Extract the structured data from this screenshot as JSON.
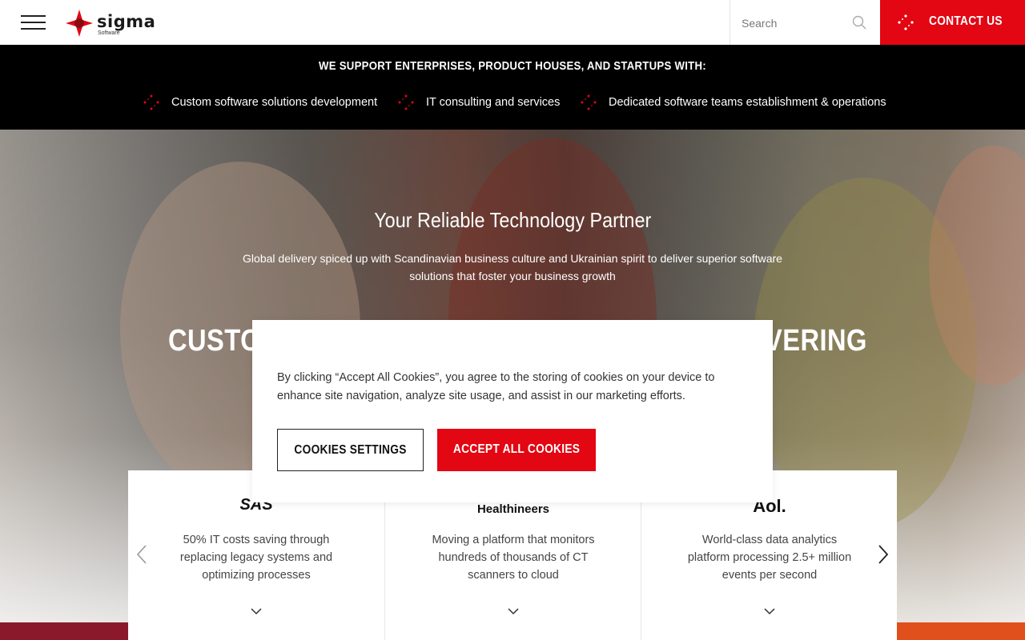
{
  "header": {
    "logo_text": "sigma",
    "logo_sub": "Software",
    "search_placeholder": "Search",
    "contact_label": "CONTACT US"
  },
  "band": {
    "title": "WE SUPPORT ENTERPRISES, PRODUCT HOUSES, AND STARTUPS WITH:",
    "items": [
      "Custom software solutions development",
      "IT consulting and services",
      "Dedicated software teams establishment & operations"
    ]
  },
  "hero": {
    "title": "Your Reliable Technology Partner",
    "subtitle": "Global delivery spiced up with Scandinavian business culture and Ukrainian spirit to deliver superior software solutions that foster your business growth",
    "big_left": "CUSTO",
    "big_right": "VERING"
  },
  "cards": [
    {
      "logo": "SAS",
      "text": "50% IT costs saving through replacing legacy systems and optimizing processes"
    },
    {
      "logo": "Healthineers",
      "text": "Moving a platform that monitors hundreds of thousands of CT scanners to cloud"
    },
    {
      "logo": "Aol.",
      "text": "World-class data analytics platform processing 2.5+ million events per second"
    }
  ],
  "cookie": {
    "text": "By clicking “Accept All Cookies”, you agree to the storing of cookies on your device to enhance site navigation, analyze site usage, and assist in our marketing efforts.",
    "settings_label": "COOKIES SETTINGS",
    "accept_label": "ACCEPT ALL COOKIES"
  },
  "colors": {
    "brand_red": "#e30613",
    "band_black": "#000000",
    "strip_left": "#8a1a2b",
    "strip_right": "#e0501c"
  },
  "icons": {
    "menu": "hamburger-icon",
    "search": "search-icon",
    "contact": "dots-icon",
    "bullet": "dots-icon",
    "chevron": "chevron-down-icon",
    "prev": "chevron-left-icon",
    "next": "chevron-right-icon"
  }
}
